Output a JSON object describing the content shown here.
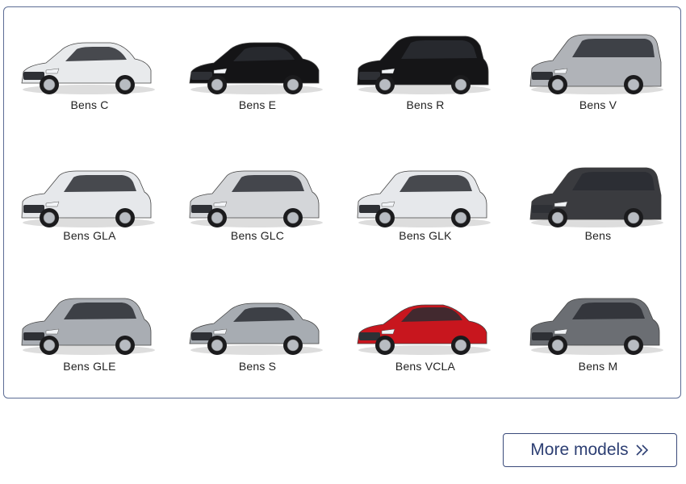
{
  "models": [
    {
      "name": "Bens C",
      "type": "sedan",
      "color": "#e8eaec"
    },
    {
      "name": "Bens E",
      "type": "sedan",
      "color": "#141416"
    },
    {
      "name": "Bens R",
      "type": "mpv",
      "color": "#151517"
    },
    {
      "name": "Bens V",
      "type": "van",
      "color": "#b0b3b8"
    },
    {
      "name": "Bens GLA",
      "type": "suv",
      "color": "#e6e8eb"
    },
    {
      "name": "Bens GLC",
      "type": "suv",
      "color": "#d4d6d9"
    },
    {
      "name": "Bens GLK",
      "type": "suv",
      "color": "#e6e8eb"
    },
    {
      "name": "Bens",
      "type": "van",
      "color": "#3a3b3f"
    },
    {
      "name": "Bens GLE",
      "type": "suv",
      "color": "#a9adb3"
    },
    {
      "name": "Bens S",
      "type": "sedan",
      "color": "#a7acb2"
    },
    {
      "name": "Bens VCLA",
      "type": "coupe",
      "color": "#c8161e"
    },
    {
      "name": "Bens M",
      "type": "suv",
      "color": "#6b6e73"
    }
  ],
  "more_button": {
    "label": "More models",
    "icon": "double-chevron-right-icon"
  },
  "colors": {
    "border": "#5c6c94",
    "accent": "#2d3f73"
  }
}
